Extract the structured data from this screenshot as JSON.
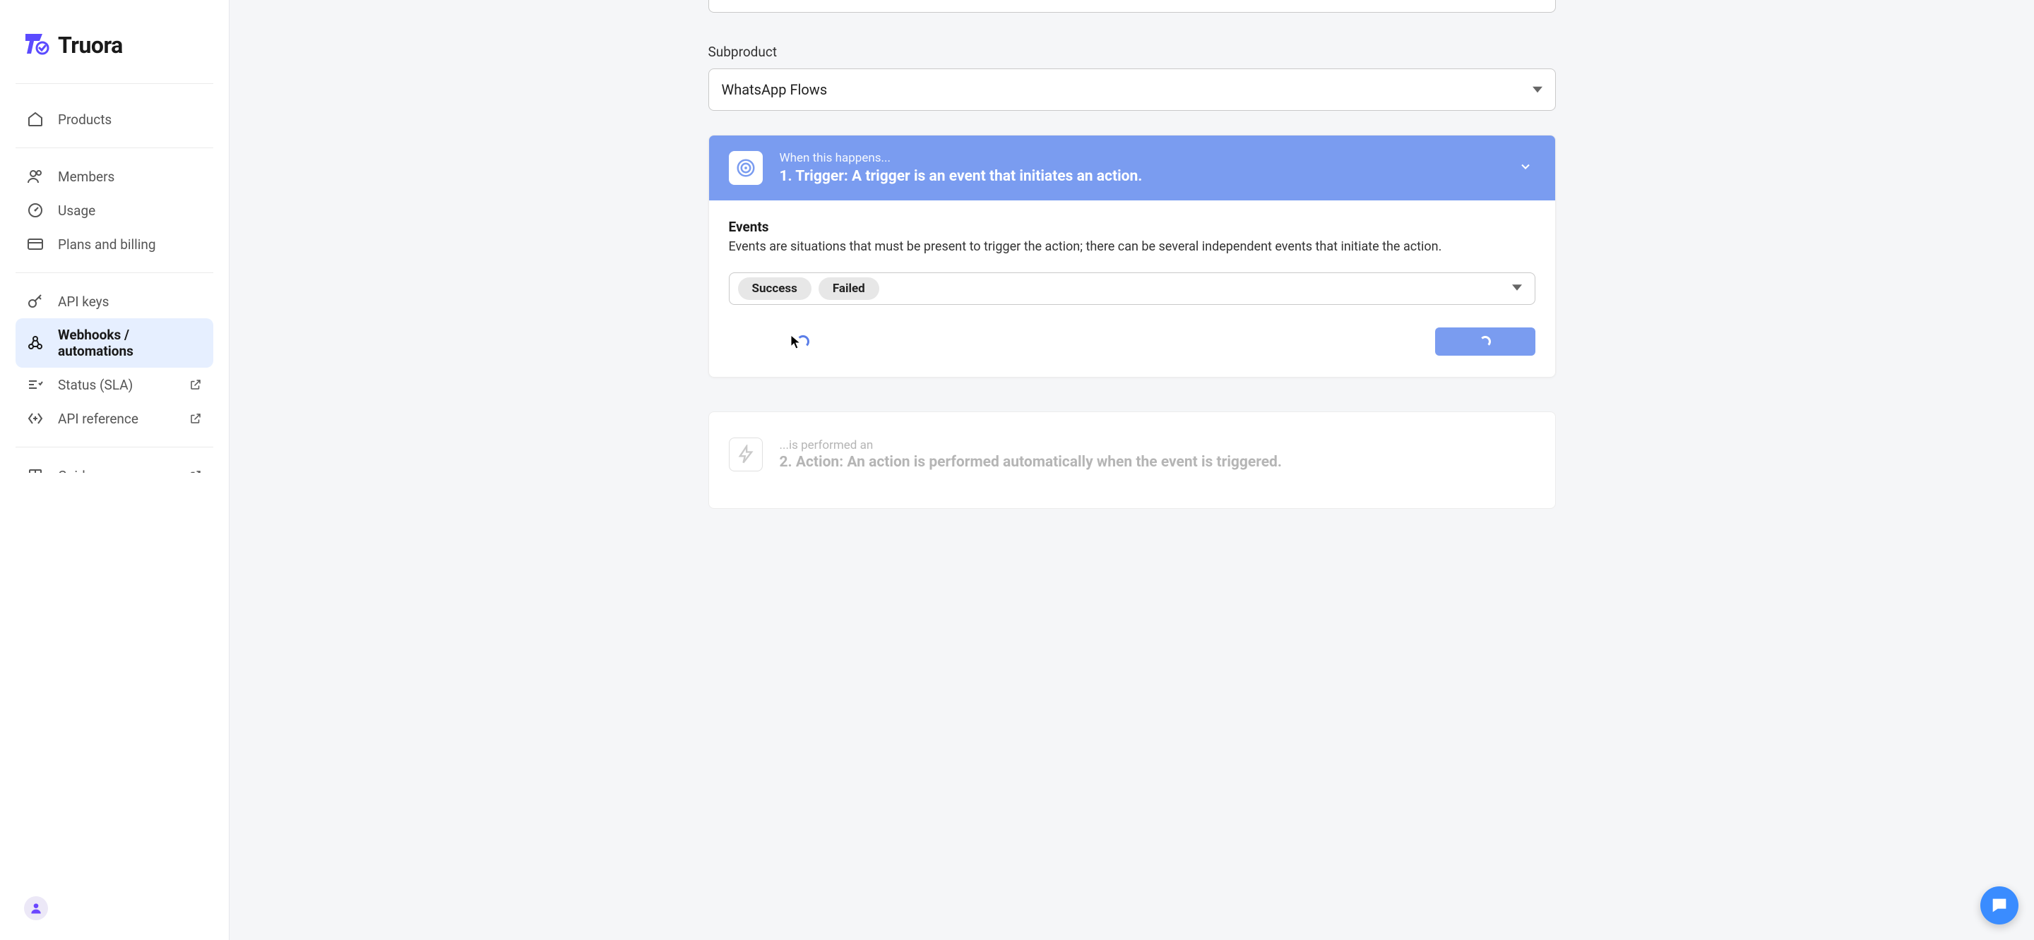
{
  "brand": {
    "name": "Truora"
  },
  "sidebar": {
    "items": [
      {
        "label": "Products"
      },
      {
        "label": "Members"
      },
      {
        "label": "Usage"
      },
      {
        "label": "Plans and billing"
      },
      {
        "label": "API keys"
      },
      {
        "label": "Webhooks / automations"
      },
      {
        "label": "Status (SLA)"
      },
      {
        "label": "API reference"
      },
      {
        "label": "Guides"
      }
    ]
  },
  "form": {
    "subproduct_label": "Subproduct",
    "subproduct_value": "WhatsApp Flows"
  },
  "trigger": {
    "subtitle": "When this happens...",
    "title": "1. Trigger: A trigger is an event that initiates an action.",
    "events_heading": "Events",
    "events_desc": "Events are situations that must be present to trigger the action; there can be several independent events that initiate the action.",
    "chips": [
      "Success",
      "Failed"
    ]
  },
  "action": {
    "subtitle": "...is performed an",
    "title": "2. Action: An action is performed automatically when the event is triggered."
  }
}
